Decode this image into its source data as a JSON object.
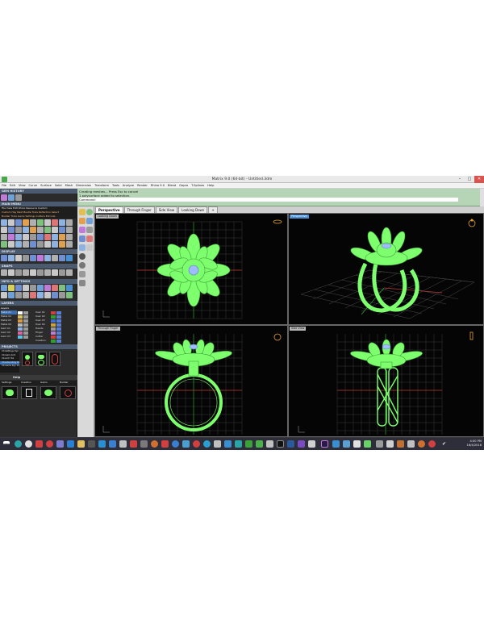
{
  "window": {
    "title": "Matrix 9.0 (64-bit) - Untitled.3dm",
    "min": "–",
    "max": "□",
    "close": "✕"
  },
  "menu": [
    "File",
    "Edit",
    "View",
    "Curve",
    "Surface",
    "Solid",
    "Mesh",
    "Dimension",
    "Transform",
    "Tools",
    "Analyze",
    "Render",
    "Rhino 9.0",
    "Blend",
    "Gopro",
    "T-Splines",
    "Help"
  ],
  "left_panel": {
    "history_header": "GEM HISTORY",
    "main_menu_header": "MAIN MENU",
    "main_menu_rows": [
      "File  View  Edit  Rhino  Resource  Custom",
      "Custom  Hey Next  Bustle  Tools  Reflection  Select",
      "Builder  Tools  Gems  Settings  Cutters  Extrude"
    ],
    "display_header": "DISPLAY",
    "snaps_header": "SNAPS",
    "info_header": "INFO & SETTINGS",
    "layers_header": "LAYERS",
    "layers_col": "Layers",
    "layers_left": [
      "Metal 01",
      "Metal 02",
      "Metal 03",
      "Metal 04",
      "Gem 01",
      "Gem 02",
      "Gem 03"
    ],
    "layers_right": [
      "User 01",
      "User 02",
      "User 03",
      "User 04",
      "Heads",
      "Finger",
      "Cutter",
      "Creation"
    ],
    "projects_header": "PROJECTS",
    "project_items": [
      "CX-Settings Dyn",
      "CX-Gem Arch",
      "CX-Arch Hol",
      "CX-Lotus Ring 01",
      "CX-Gems Dyn 01"
    ],
    "help": "Help",
    "bottom_labels": [
      "Settings",
      "Creation",
      "Gems",
      "Builder"
    ]
  },
  "command": {
    "lines": [
      "Creating meshes... Press Esc to cancel",
      "1 polysurface added to selection.",
      "Command:"
    ]
  },
  "tabs": [
    "Perspective",
    "Through Finger",
    "Side View",
    "Looking Down",
    "+"
  ],
  "viewports": {
    "top_left": "Looking Down",
    "top_right": "Perspective",
    "bottom_left": "Through Finger",
    "bottom_right": "Side View"
  },
  "clock": {
    "time": "4:00 PM",
    "date": "16/4/2018"
  },
  "colors": {
    "wire": "#7dff6e",
    "gem": "#9fbcff",
    "grid": "#3a3a3a",
    "axis_red": "#c23b3b",
    "axis_green": "#2aa52a",
    "active_label": "#4b8fd3"
  }
}
